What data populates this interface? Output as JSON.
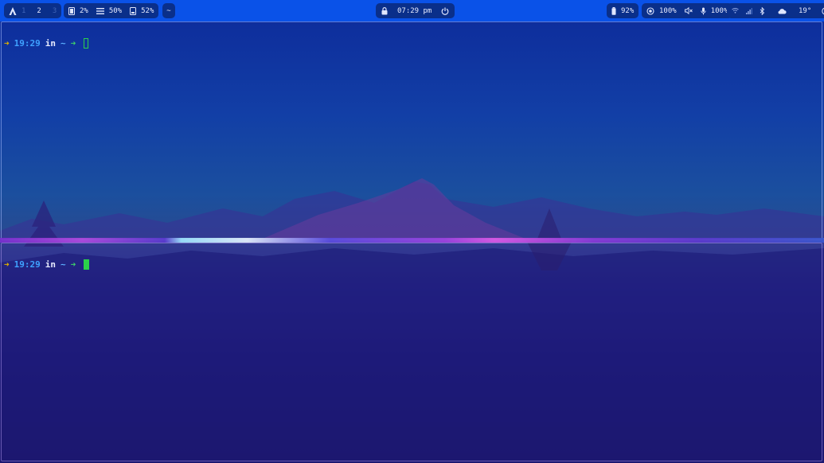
{
  "topbar": {
    "workspaces": [
      "1",
      "2",
      "3"
    ],
    "active_workspace": "2",
    "cpu": "2%",
    "memory": "50%",
    "disk": "52%",
    "window_title": "~",
    "clock": "07:29 pm",
    "battery": "92%",
    "brightness": "100%",
    "volume": "100%",
    "weather_temp": "19°"
  },
  "terminal_top": {
    "time": "19:29",
    "in": "in",
    "dir": "~"
  },
  "terminal_bottom": {
    "time": "19:29",
    "in": "in",
    "dir": "~"
  },
  "colors": {
    "bar": "#0a52e8",
    "pill": "#0a2f8a",
    "accent_green": "#2bd04a",
    "accent_blue": "#3fa2ff",
    "accent_yellow": "#e0b000"
  }
}
